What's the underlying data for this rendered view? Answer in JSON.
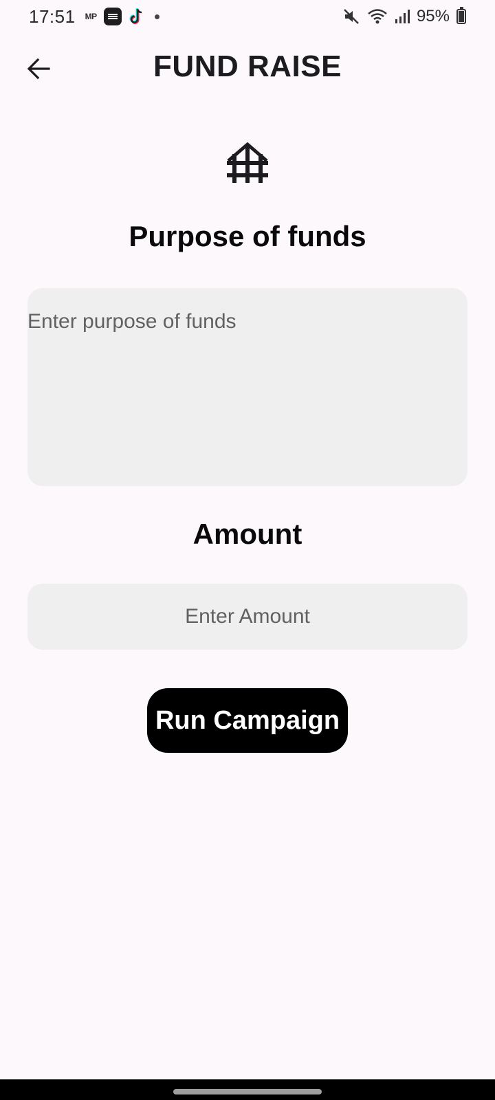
{
  "status_bar": {
    "time": "17:51",
    "carrier_badge": "MP",
    "battery_percent": "95%",
    "icons": [
      "app-badge-icon",
      "tiktok-icon",
      "dot-icon",
      "mute-icon",
      "wifi-icon",
      "signal-icon",
      "battery-icon"
    ]
  },
  "app_bar": {
    "title": "FUND RAISE",
    "back_icon": "arrow-back-icon"
  },
  "hero_icon": "temple-icon",
  "purpose": {
    "label": "Purpose of funds",
    "placeholder": "Enter purpose of funds",
    "value": ""
  },
  "amount": {
    "label": "Amount",
    "placeholder": "Enter Amount",
    "value": ""
  },
  "actions": {
    "run_campaign_label": "Run Campaign"
  },
  "colors": {
    "background": "#fdf8fc",
    "field": "#efefef",
    "button": "#000000",
    "button_text": "#ffffff"
  }
}
